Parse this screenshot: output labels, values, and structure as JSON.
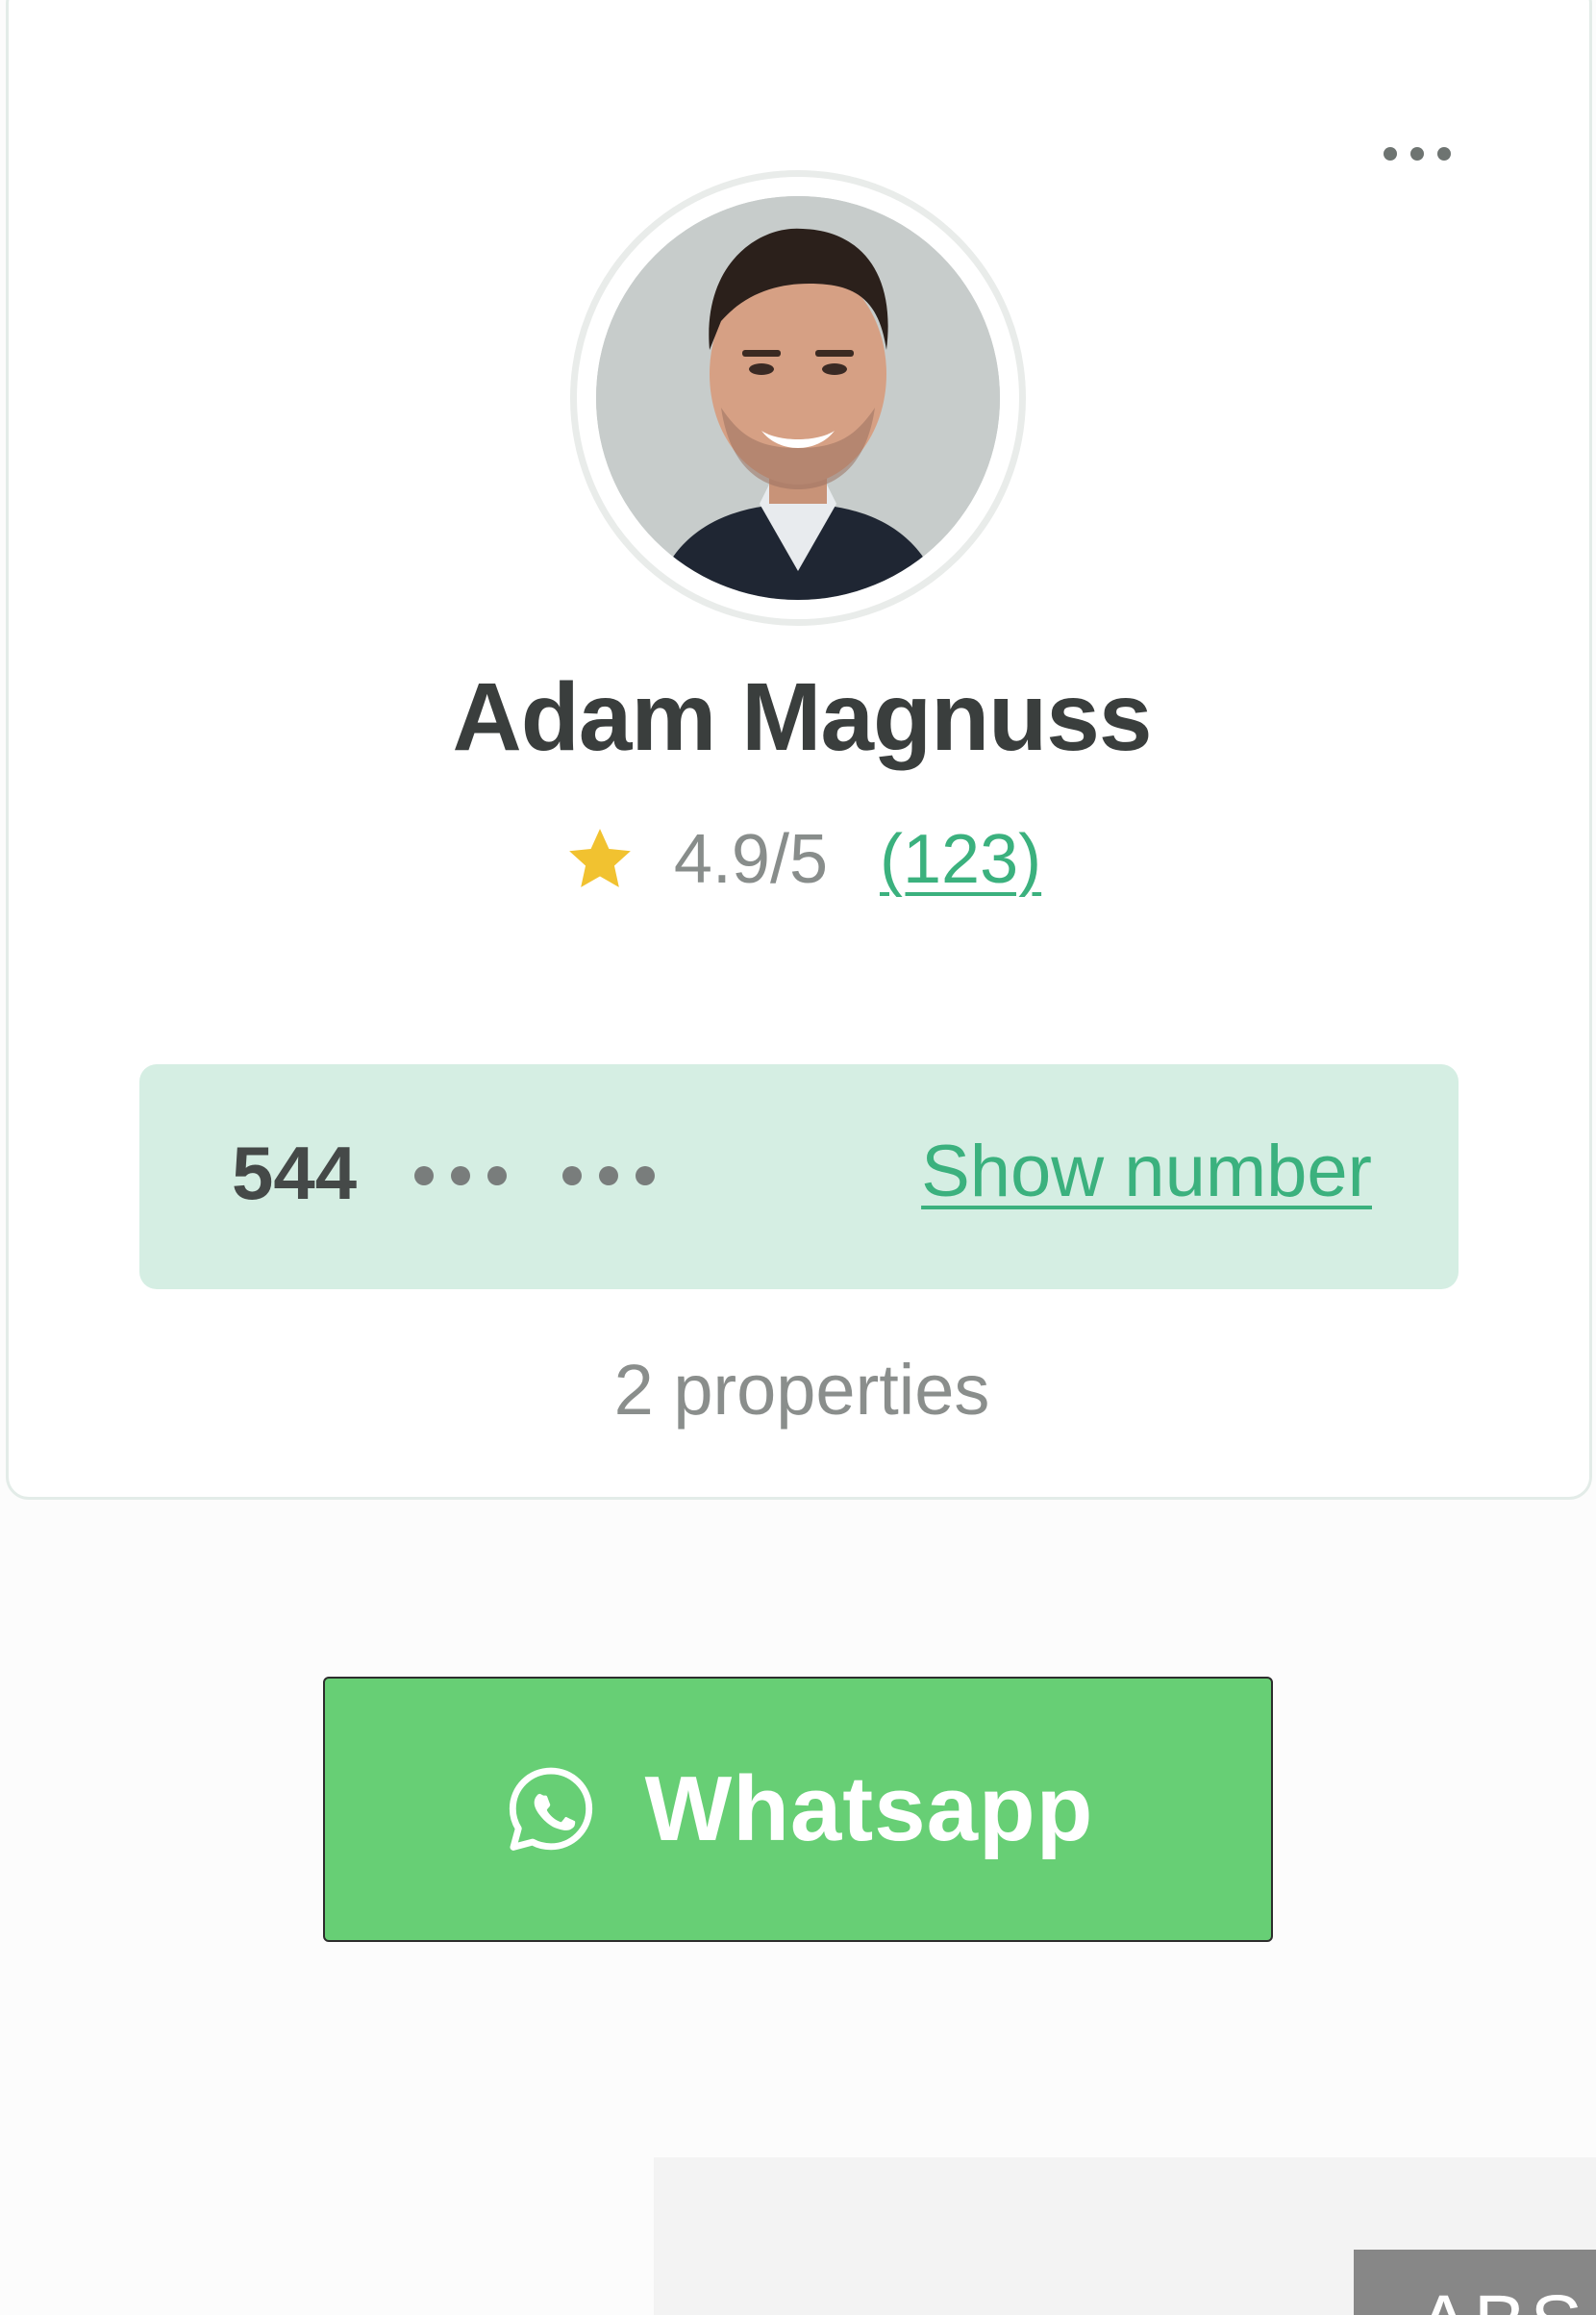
{
  "agent_card": {
    "more_icon": "more-horizontal-icon",
    "avatar_icon": "agent-photo",
    "name": "Adam Magnuss",
    "rating": {
      "star_icon": "star-icon",
      "star_color": "#f1c230",
      "value": "4.9/5",
      "reviews_link": "(123)"
    },
    "phone": {
      "prefix": "544",
      "masked": "••• •••",
      "show_link": "Show number"
    },
    "properties": "2 properties"
  },
  "whatsapp": {
    "icon": "whatsapp-icon",
    "label": "Whatsapp",
    "color": "#67cf75"
  },
  "bottom": {
    "tab_label": "ABS"
  },
  "colors": {
    "accent_green": "#3bb17e",
    "phone_box_bg": "#d5eee3"
  }
}
